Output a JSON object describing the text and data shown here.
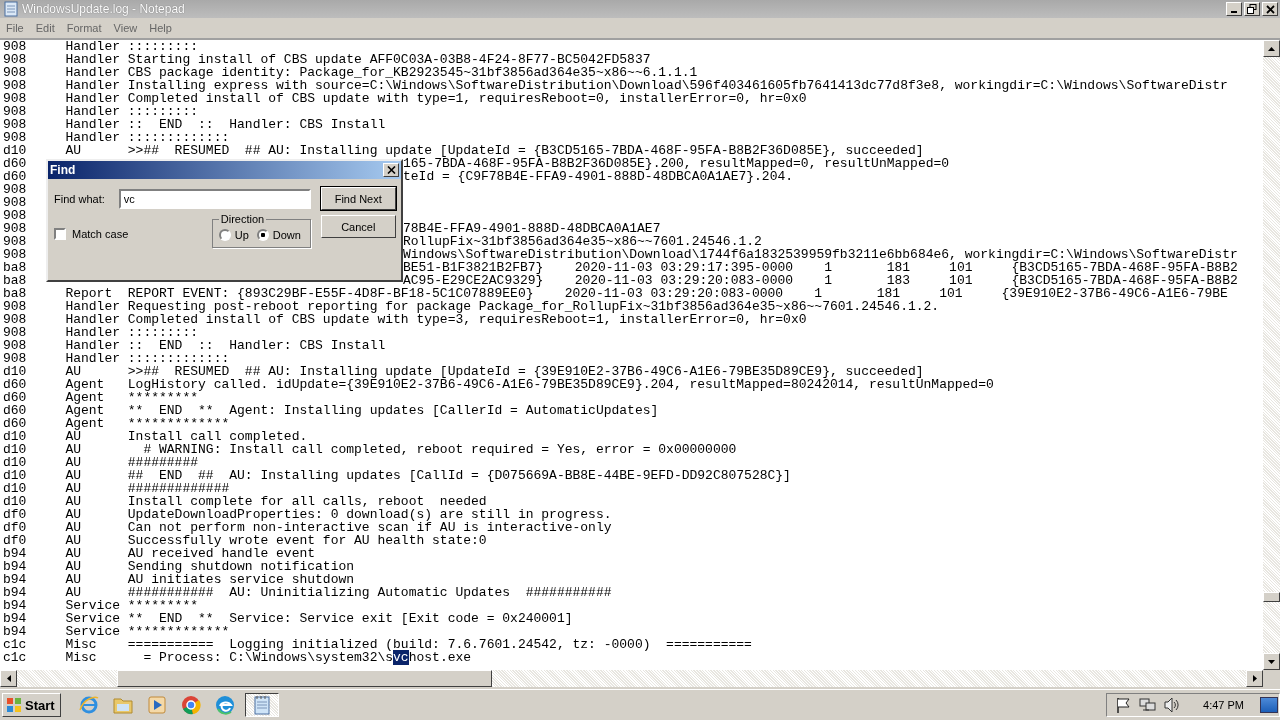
{
  "window": {
    "title": "WindowsUpdate.log - Notepad"
  },
  "menu": [
    "File",
    "Edit",
    "Format",
    "View",
    "Help"
  ],
  "log_lines": [
    {
      "kind": "entry",
      "thread": "908",
      "component": "Handler",
      "message": ":::::::::"
    },
    {
      "kind": "entry",
      "thread": "908",
      "component": "Handler",
      "message": "Starting install of CBS update AFF0C03A-03B8-4F24-8F77-BC5042FD5837"
    },
    {
      "kind": "entry",
      "thread": "908",
      "component": "Handler",
      "message": "CBS package identity: Package_for_KB2923545~31bf3856ad364e35~x86~~6.1.1.1"
    },
    {
      "kind": "entry",
      "thread": "908",
      "component": "Handler",
      "message": "Installing express with source=C:\\Windows\\SoftwareDistribution\\Download\\596f403461605fb7641413dc77d8f3e8, workingdir=C:\\Windows\\SoftwareDistr"
    },
    {
      "kind": "entry",
      "thread": "908",
      "component": "Handler",
      "message": "Completed install of CBS update with type=1, requiresReboot=0, installerError=0, hr=0x0"
    },
    {
      "kind": "entry",
      "thread": "908",
      "component": "Handler",
      "message": ":::::::::"
    },
    {
      "kind": "entry",
      "thread": "908",
      "component": "Handler",
      "message": "::  END  ::  Handler: CBS Install"
    },
    {
      "kind": "entry",
      "thread": "908",
      "component": "Handler",
      "message": ":::::::::::::"
    },
    {
      "kind": "entry",
      "thread": "d10",
      "component": "AU",
      "message": ">>##  RESUMED  ## AU: Installing update [UpdateId = {B3CD5165-7BDA-468F-95FA-B8B2F36D085E}, succeeded]"
    },
    {
      "kind": "covered",
      "thread": "d60",
      "tail": "165-7BDA-468F-95FA-B8B2F36D085E}.200, resultMapped=0, resultUnMapped=0"
    },
    {
      "kind": "covered",
      "thread": "d60",
      "tail": "teId = {C9F78B4E-FFA9-4901-888D-48DBCA0A1AE7}.204."
    },
    {
      "kind": "covered",
      "thread": "908"
    },
    {
      "kind": "covered",
      "thread": "908"
    },
    {
      "kind": "covered",
      "thread": "908"
    },
    {
      "kind": "covered",
      "thread": "908",
      "tail": "78B4E-FFA9-4901-888D-48DBCA0A1AE7"
    },
    {
      "kind": "covered",
      "thread": "908",
      "tail": "RollupFix~31bf3856ad364e35~x86~~7601.24546.1.2"
    },
    {
      "kind": "covered",
      "thread": "908",
      "tail": "Windows\\SoftwareDistribution\\Download\\1744f6a1832539959fb3211e6bb684e6, workingdir=C:\\Windows\\SoftwareDistr"
    },
    {
      "kind": "covered",
      "thread": "ba8",
      "tail": "BE51-B1F3821B2FB7}    2020-11-03 03:29:17:395-0000    1       181     101     {B3CD5165-7BDA-468F-95FA-B8B2"
    },
    {
      "kind": "covered",
      "thread": "ba8",
      "tail": "AC95-E29CE2AC9329}    2020-11-03 03:29:20:083-0000    1       183     101     {B3CD5165-7BDA-468F-95FA-B8B2"
    },
    {
      "kind": "entry",
      "thread": "ba8",
      "component": "Report",
      "message": "REPORT EVENT: {893C29BF-E55F-4D8F-BF18-5C1C07889EE0}    2020-11-03 03:29:20:083-0000    1       181     101     {39E910E2-37B6-49C6-A1E6-79BE"
    },
    {
      "kind": "entry",
      "thread": "908",
      "component": "Handler",
      "message": "Requesting post-reboot reporting for package Package_for_RollupFix~31bf3856ad364e35~x86~~7601.24546.1.2."
    },
    {
      "kind": "entry",
      "thread": "908",
      "component": "Handler",
      "message": "Completed install of CBS update with type=3, requiresReboot=1, installerError=0, hr=0x0"
    },
    {
      "kind": "entry",
      "thread": "908",
      "component": "Handler",
      "message": ":::::::::"
    },
    {
      "kind": "entry",
      "thread": "908",
      "component": "Handler",
      "message": "::  END  ::  Handler: CBS Install"
    },
    {
      "kind": "entry",
      "thread": "908",
      "component": "Handler",
      "message": ":::::::::::::"
    },
    {
      "kind": "entry",
      "thread": "d10",
      "component": "AU",
      "message": ">>##  RESUMED  ## AU: Installing update [UpdateId = {39E910E2-37B6-49C6-A1E6-79BE35D89CE9}, succeeded]"
    },
    {
      "kind": "entry",
      "thread": "d60",
      "component": "Agent",
      "message": "LogHistory called. idUpdate={39E910E2-37B6-49C6-A1E6-79BE35D89CE9}.204, resultMapped=80242014, resultUnMapped=0"
    },
    {
      "kind": "entry",
      "thread": "d60",
      "component": "Agent",
      "message": "*********"
    },
    {
      "kind": "entry",
      "thread": "d60",
      "component": "Agent",
      "message": "**  END  **  Agent: Installing updates [CallerId = AutomaticUpdates]"
    },
    {
      "kind": "entry",
      "thread": "d60",
      "component": "Agent",
      "message": "*************"
    },
    {
      "kind": "entry",
      "thread": "d10",
      "component": "AU",
      "message": "Install call completed."
    },
    {
      "kind": "entry",
      "thread": "d10",
      "component": "AU",
      "message": "  # WARNING: Install call completed, reboot required = Yes, error = 0x00000000"
    },
    {
      "kind": "entry",
      "thread": "d10",
      "component": "AU",
      "message": "#########"
    },
    {
      "kind": "entry",
      "thread": "d10",
      "component": "AU",
      "message": "##  END  ##  AU: Installing updates [CallId = {D075669A-BB8E-44BE-9EFD-DD92C807528C}]"
    },
    {
      "kind": "entry",
      "thread": "d10",
      "component": "AU",
      "message": "#############"
    },
    {
      "kind": "entry",
      "thread": "d10",
      "component": "AU",
      "message": "Install complete for all calls, reboot  needed"
    },
    {
      "kind": "entry",
      "thread": "df0",
      "component": "AU",
      "message": "UpdateDownloadProperties: 0 download(s) are still in progress."
    },
    {
      "kind": "entry",
      "thread": "df0",
      "component": "AU",
      "message": "Can not perform non-interactive scan if AU is interactive-only"
    },
    {
      "kind": "entry",
      "thread": "df0",
      "component": "AU",
      "message": "Successfully wrote event for AU health state:0"
    },
    {
      "kind": "entry",
      "thread": "b94",
      "component": "AU",
      "message": "AU received handle event"
    },
    {
      "kind": "entry",
      "thread": "b94",
      "component": "AU",
      "message": "Sending shutdown notification"
    },
    {
      "kind": "entry",
      "thread": "b94",
      "component": "AU",
      "message": "AU initiates service shutdown"
    },
    {
      "kind": "entry",
      "thread": "b94",
      "component": "AU",
      "message": "###########  AU: Uninitializing Automatic Updates  ###########"
    },
    {
      "kind": "entry",
      "thread": "b94",
      "component": "Service",
      "message": "*********"
    },
    {
      "kind": "entry",
      "thread": "b94",
      "component": "Service",
      "message": "**  END  **  Service: Service exit [Exit code = 0x240001]"
    },
    {
      "kind": "entry",
      "thread": "b94",
      "component": "Service",
      "message": "*************"
    },
    {
      "kind": "entry",
      "thread": "c1c",
      "component": "Misc",
      "message": "===========  Logging initialized (build: 7.6.7601.24542, tz: -0000)  ==========="
    },
    {
      "kind": "entry",
      "thread": "c1c",
      "component": "Misc",
      "message_parts": [
        {
          "text": "  = Process: C:\\Windows\\system32\\s",
          "selected": false
        },
        {
          "text": "vc",
          "selected": true
        },
        {
          "text": "host.exe",
          "selected": false
        }
      ]
    }
  ],
  "find_dialog": {
    "title": "Find",
    "find_what_label": "Find what:",
    "find_what_value": "vc",
    "buttons": [
      {
        "label": "Find Next",
        "default": true
      },
      {
        "label": "Cancel",
        "default": false
      }
    ],
    "direction": {
      "label": "Direction",
      "options": [
        {
          "label": "Up",
          "selected": false
        },
        {
          "label": "Down",
          "selected": true
        }
      ]
    },
    "match_case": {
      "label": "Match case",
      "checked": false
    }
  },
  "taskbar": {
    "start_label": "Start",
    "apps": [
      {
        "kind": "ie",
        "selected": false
      },
      {
        "kind": "folder",
        "selected": false
      },
      {
        "kind": "media",
        "selected": false
      },
      {
        "kind": "chrome",
        "selected": false
      },
      {
        "kind": "edge",
        "selected": false
      },
      {
        "kind": "notepad",
        "selected": true
      }
    ],
    "clock": "4:47 PM"
  }
}
